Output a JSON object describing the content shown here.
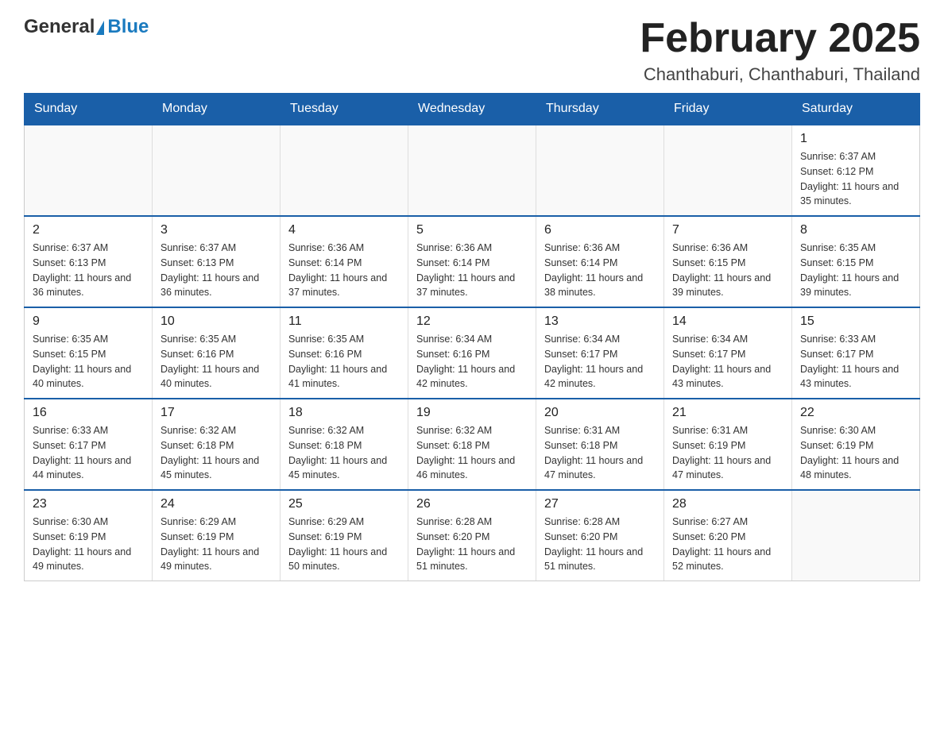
{
  "header": {
    "logo": {
      "general": "General",
      "blue": "Blue"
    },
    "title": "February 2025",
    "location": "Chanthaburi, Chanthaburi, Thailand"
  },
  "calendar": {
    "days_of_week": [
      "Sunday",
      "Monday",
      "Tuesday",
      "Wednesday",
      "Thursday",
      "Friday",
      "Saturday"
    ],
    "weeks": [
      [
        {
          "day": "",
          "info": ""
        },
        {
          "day": "",
          "info": ""
        },
        {
          "day": "",
          "info": ""
        },
        {
          "day": "",
          "info": ""
        },
        {
          "day": "",
          "info": ""
        },
        {
          "day": "",
          "info": ""
        },
        {
          "day": "1",
          "info": "Sunrise: 6:37 AM\nSunset: 6:12 PM\nDaylight: 11 hours\nand 35 minutes."
        }
      ],
      [
        {
          "day": "2",
          "info": "Sunrise: 6:37 AM\nSunset: 6:13 PM\nDaylight: 11 hours\nand 36 minutes."
        },
        {
          "day": "3",
          "info": "Sunrise: 6:37 AM\nSunset: 6:13 PM\nDaylight: 11 hours\nand 36 minutes."
        },
        {
          "day": "4",
          "info": "Sunrise: 6:36 AM\nSunset: 6:14 PM\nDaylight: 11 hours\nand 37 minutes."
        },
        {
          "day": "5",
          "info": "Sunrise: 6:36 AM\nSunset: 6:14 PM\nDaylight: 11 hours\nand 37 minutes."
        },
        {
          "day": "6",
          "info": "Sunrise: 6:36 AM\nSunset: 6:14 PM\nDaylight: 11 hours\nand 38 minutes."
        },
        {
          "day": "7",
          "info": "Sunrise: 6:36 AM\nSunset: 6:15 PM\nDaylight: 11 hours\nand 39 minutes."
        },
        {
          "day": "8",
          "info": "Sunrise: 6:35 AM\nSunset: 6:15 PM\nDaylight: 11 hours\nand 39 minutes."
        }
      ],
      [
        {
          "day": "9",
          "info": "Sunrise: 6:35 AM\nSunset: 6:15 PM\nDaylight: 11 hours\nand 40 minutes."
        },
        {
          "day": "10",
          "info": "Sunrise: 6:35 AM\nSunset: 6:16 PM\nDaylight: 11 hours\nand 40 minutes."
        },
        {
          "day": "11",
          "info": "Sunrise: 6:35 AM\nSunset: 6:16 PM\nDaylight: 11 hours\nand 41 minutes."
        },
        {
          "day": "12",
          "info": "Sunrise: 6:34 AM\nSunset: 6:16 PM\nDaylight: 11 hours\nand 42 minutes."
        },
        {
          "day": "13",
          "info": "Sunrise: 6:34 AM\nSunset: 6:17 PM\nDaylight: 11 hours\nand 42 minutes."
        },
        {
          "day": "14",
          "info": "Sunrise: 6:34 AM\nSunset: 6:17 PM\nDaylight: 11 hours\nand 43 minutes."
        },
        {
          "day": "15",
          "info": "Sunrise: 6:33 AM\nSunset: 6:17 PM\nDaylight: 11 hours\nand 43 minutes."
        }
      ],
      [
        {
          "day": "16",
          "info": "Sunrise: 6:33 AM\nSunset: 6:17 PM\nDaylight: 11 hours\nand 44 minutes."
        },
        {
          "day": "17",
          "info": "Sunrise: 6:32 AM\nSunset: 6:18 PM\nDaylight: 11 hours\nand 45 minutes."
        },
        {
          "day": "18",
          "info": "Sunrise: 6:32 AM\nSunset: 6:18 PM\nDaylight: 11 hours\nand 45 minutes."
        },
        {
          "day": "19",
          "info": "Sunrise: 6:32 AM\nSunset: 6:18 PM\nDaylight: 11 hours\nand 46 minutes."
        },
        {
          "day": "20",
          "info": "Sunrise: 6:31 AM\nSunset: 6:18 PM\nDaylight: 11 hours\nand 47 minutes."
        },
        {
          "day": "21",
          "info": "Sunrise: 6:31 AM\nSunset: 6:19 PM\nDaylight: 11 hours\nand 47 minutes."
        },
        {
          "day": "22",
          "info": "Sunrise: 6:30 AM\nSunset: 6:19 PM\nDaylight: 11 hours\nand 48 minutes."
        }
      ],
      [
        {
          "day": "23",
          "info": "Sunrise: 6:30 AM\nSunset: 6:19 PM\nDaylight: 11 hours\nand 49 minutes."
        },
        {
          "day": "24",
          "info": "Sunrise: 6:29 AM\nSunset: 6:19 PM\nDaylight: 11 hours\nand 49 minutes."
        },
        {
          "day": "25",
          "info": "Sunrise: 6:29 AM\nSunset: 6:19 PM\nDaylight: 11 hours\nand 50 minutes."
        },
        {
          "day": "26",
          "info": "Sunrise: 6:28 AM\nSunset: 6:20 PM\nDaylight: 11 hours\nand 51 minutes."
        },
        {
          "day": "27",
          "info": "Sunrise: 6:28 AM\nSunset: 6:20 PM\nDaylight: 11 hours\nand 51 minutes."
        },
        {
          "day": "28",
          "info": "Sunrise: 6:27 AM\nSunset: 6:20 PM\nDaylight: 11 hours\nand 52 minutes."
        },
        {
          "day": "",
          "info": ""
        }
      ]
    ]
  }
}
